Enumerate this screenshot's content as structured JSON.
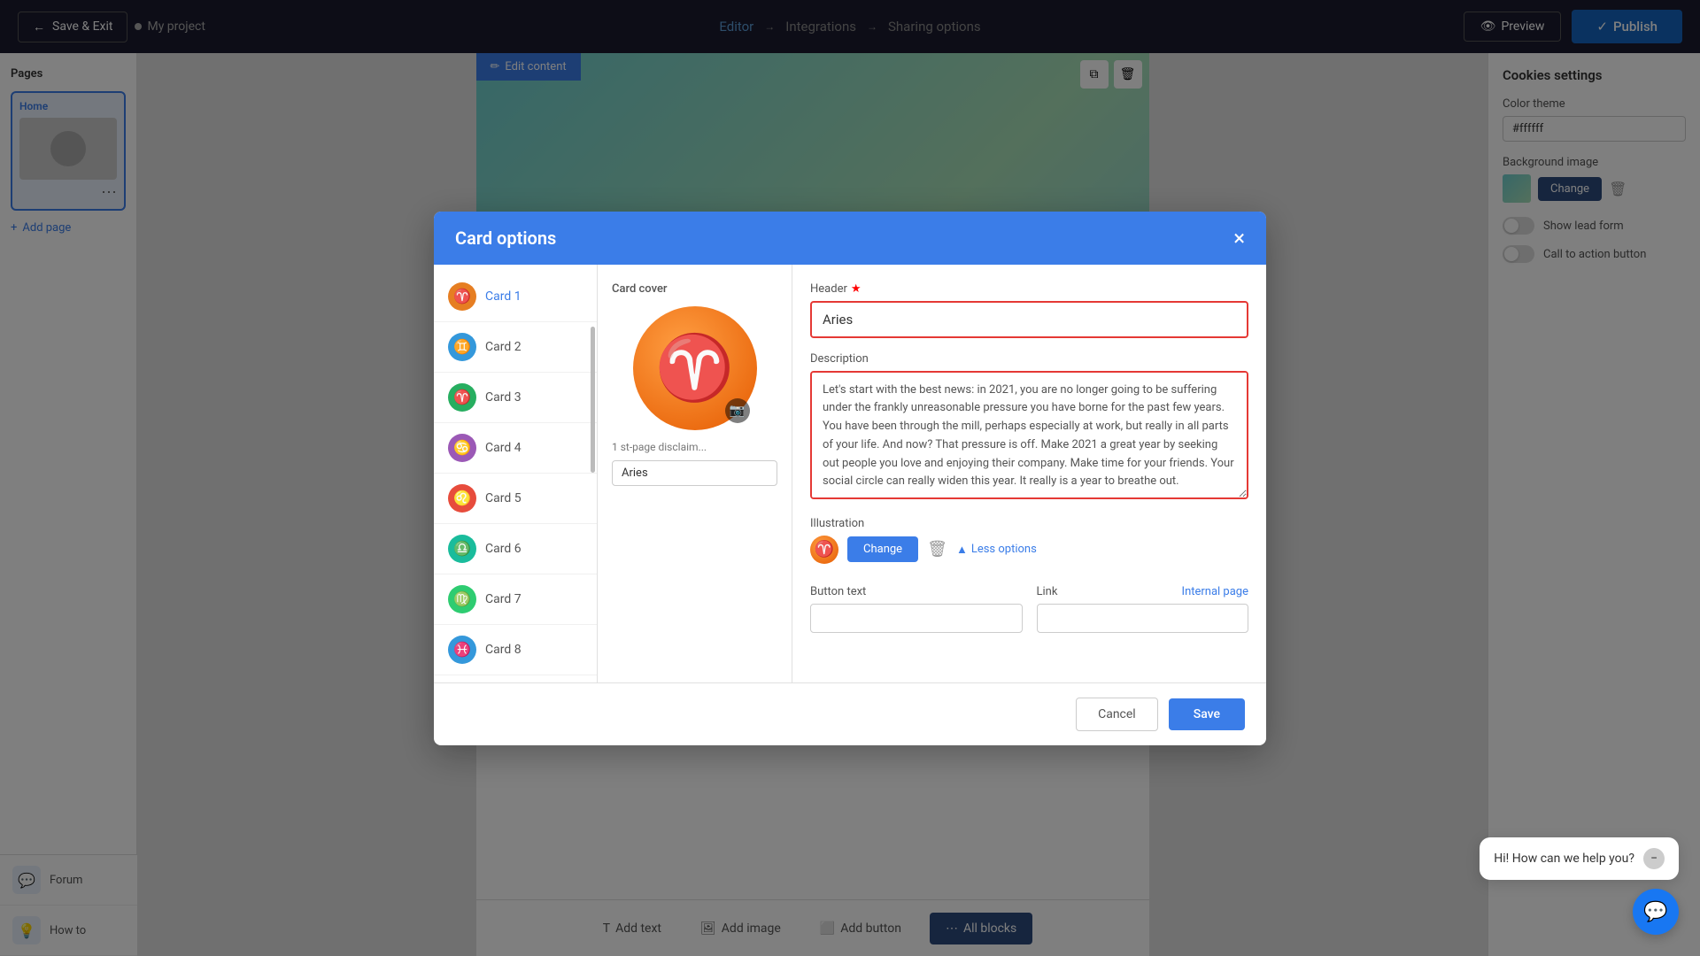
{
  "topNav": {
    "saveExitLabel": "Save & Exit",
    "projectName": "My project",
    "steps": [
      {
        "label": "Editor",
        "state": "active"
      },
      {
        "label": "Integrations",
        "state": "inactive"
      },
      {
        "label": "Sharing options",
        "state": "inactive"
      }
    ],
    "previewLabel": "Preview",
    "publishLabel": "Publish"
  },
  "leftSidebar": {
    "pagesTitle": "Pages",
    "homePage": "Home",
    "addPageLabel": "Add page"
  },
  "rightSidebar": {
    "title": "Cookies settings",
    "colorThemeLabel": "Color theme",
    "colorThemeValue": "#ffffff",
    "backgroundImageLabel": "Background image",
    "changeLabel": "Change",
    "showLeadFormLabel": "Show lead form",
    "callToActionLabel": "Call to action button"
  },
  "bottomToolbar": {
    "addTextLabel": "Add text",
    "addImageLabel": "Add image",
    "addButtonLabel": "Add button",
    "allBlocksLabel": "All blocks"
  },
  "bottomHelpers": [
    {
      "label": "Forum",
      "icon": "💬"
    },
    {
      "label": "How to",
      "icon": "💡"
    }
  ],
  "modal": {
    "title": "Card options",
    "closeLabel": "×",
    "cards": [
      {
        "id": 1,
        "label": "Card 1",
        "color": "#e67e22",
        "icon": "♈"
      },
      {
        "id": 2,
        "label": "Card 2",
        "color": "#3498db",
        "icon": "♊"
      },
      {
        "id": 3,
        "label": "Card 3",
        "color": "#27ae60",
        "icon": "♈"
      },
      {
        "id": 4,
        "label": "Card 4",
        "color": "#9b59b6",
        "icon": "♋"
      },
      {
        "id": 5,
        "label": "Card 5",
        "color": "#e74c3c",
        "icon": "♌"
      },
      {
        "id": 6,
        "label": "Card 6",
        "color": "#1abc9c",
        "icon": "♎"
      },
      {
        "id": 7,
        "label": "Card 7",
        "color": "#2ecc71",
        "icon": "♍"
      },
      {
        "id": 8,
        "label": "Card 8",
        "color": "#3498db",
        "icon": "♓"
      }
    ],
    "cardCoverLabel": "Card cover",
    "cardCoverIcon": "♈",
    "disclaimerLabel": "1 st-page disclaim...",
    "disclaimerValue": "Aries",
    "headerLabel": "Header",
    "headerRequired": true,
    "headerValue": "Aries",
    "descriptionLabel": "Description",
    "descriptionValue": "Let's start with the best news: in 2021, you are no longer going to be suffering under the frankly unreasonable pressure you have borne for the past few years. You have been through the mill, perhaps especially at work, but really in all parts of your life. And now? That pressure is off. Make 2021 a great year by seeking out people you love and enjoying their company. Make time for your friends. Your social circle can really widen this year. It really is a year to breathe out.",
    "illustrationLabel": "Illustration",
    "illustrationChangeLabel": "Change",
    "lessOptionsLabel": "Less options",
    "buttonTextLabel": "Button text",
    "linkLabel": "Link",
    "internalPageLabel": "Internal page",
    "buttonTextValue": "",
    "linkValue": "",
    "cancelLabel": "Cancel",
    "saveLabel": "Save"
  },
  "chat": {
    "message": "Hi! How can we help you?"
  }
}
